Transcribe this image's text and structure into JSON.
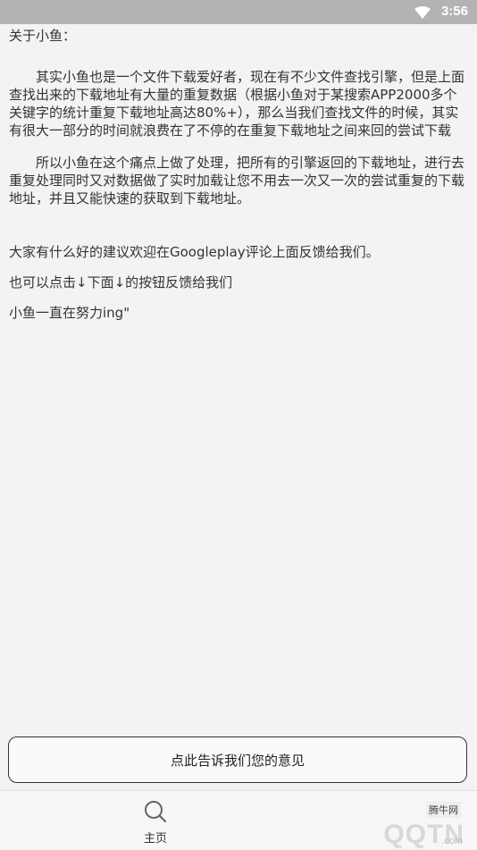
{
  "status_bar": {
    "time": "3:56",
    "icons": [
      "wifi-icon",
      "battery-icon"
    ]
  },
  "about": {
    "title": "关于小鱼：",
    "para1": "其实小鱼也是一个文件下载爱好者，现在有不少文件查找引擎，但是上面查找出来的下载地址有大量的重复数据（根据小鱼对于某搜索APP2000多个关键字的统计重复下载地址高达80%+），那么当我们查找文件的时候，其实有很大一部分的时间就浪费在了不停的在重复下载地址之间来回的尝试下载",
    "para2": "所以小鱼在这个痛点上做了处理，把所有的引擎返回的下载地址，进行去重复处理同时又对数据做了实时加载让您不用去一次又一次的尝试重复的下载地址，并且又能快速的获取到下载地址。",
    "line1": "大家有什么好的建议欢迎在Googleplay评论上面反馈给我们。",
    "line2": "也可以点击↓下面↓的按钮反馈给我们",
    "line3": "小鱼一直在努力ing\""
  },
  "feedback_button": "点此告诉我们您的意见",
  "bottom_nav": {
    "home_label": "主页",
    "home_icon": "search-icon"
  },
  "watermark": {
    "text": "QQTN",
    "small": "腾牛网",
    "sub": ".com"
  }
}
